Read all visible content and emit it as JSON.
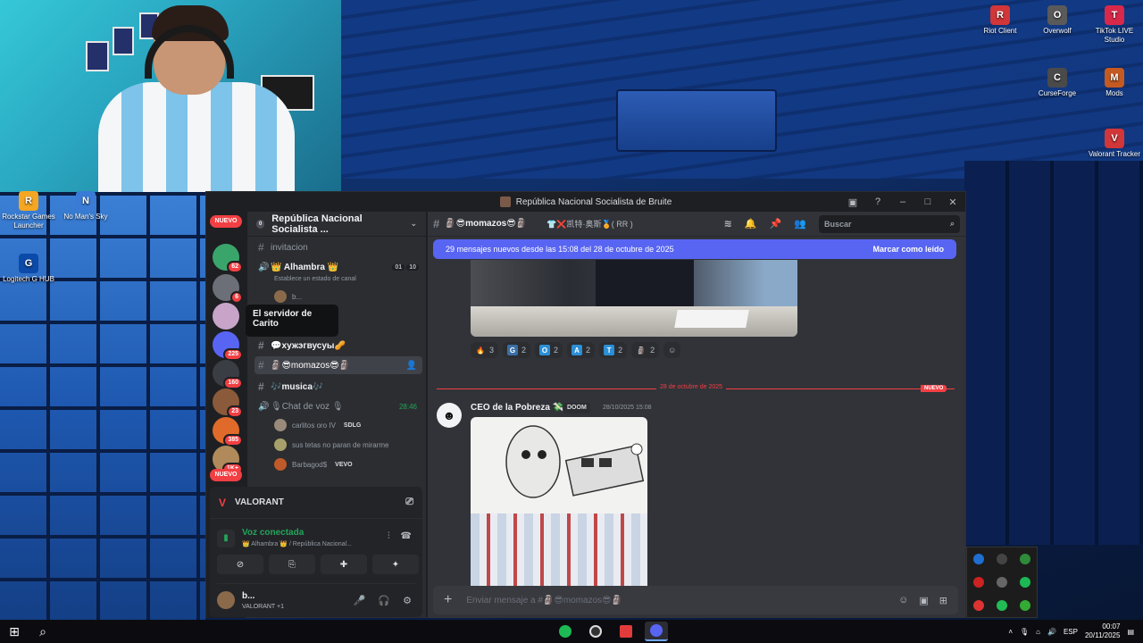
{
  "desktop": {
    "icons": [
      {
        "label": "Riot Client",
        "color": "#d13639",
        "glyph": "R"
      },
      {
        "label": "Overwolf",
        "color": "#5a5a5a",
        "glyph": "O"
      },
      {
        "label": "TikTok LIVE Studio",
        "color": "#d8294a",
        "glyph": "T"
      },
      {
        "label": "CurseForge",
        "color": "#4a4a4a",
        "glyph": "C"
      },
      {
        "label": "Mods",
        "color": "#c45a22",
        "glyph": "M"
      },
      {
        "label": "Valorant Tracker",
        "color": "#d13639",
        "glyph": "V"
      },
      {
        "label": "Rockstar Games Launcher",
        "color": "#f5a623",
        "glyph": "R"
      },
      {
        "label": "No Man's Sky",
        "color": "#3a7bd5",
        "glyph": "N"
      },
      {
        "label": "Logitech G HUB",
        "color": "#0b4aa8",
        "glyph": "G"
      }
    ]
  },
  "window": {
    "title": "República Nacional Socialista de Bruite"
  },
  "rail": {
    "nuevo_top": "NUEVO",
    "nuevo_bottom": "NUEVO",
    "badges": [
      "62",
      "6",
      "225",
      "160",
      "23",
      "385",
      "1K+"
    ]
  },
  "tooltip": {
    "text": "El servidor de Carito"
  },
  "guild": {
    "name": "República Nacional Socialista ..."
  },
  "channels": {
    "invitacion": "invitacion",
    "alhambra": "👑 Alhambra 👑",
    "alhambra_counts": [
      "01",
      "10"
    ],
    "alhambra_sub": "Establece un estado de canal",
    "alhambra_user": "b...",
    "xuj": "💬хужэгвусуы🥜",
    "momazos": "🗿😎momazos😎🗿",
    "musica": "🎶musica🎶",
    "voz": "🎙Chat de voz 🎙",
    "voz_time": "28:46",
    "voice_users": [
      {
        "name": "carlitos oro IV",
        "tag": "SDLG"
      },
      {
        "name": "sus tetas no paran de mirarme",
        "tag": ""
      },
      {
        "name": "Barbagod$",
        "tag": "VEVO"
      }
    ]
  },
  "panel": {
    "activity": "VALORANT",
    "voice_status": "Voz conectada",
    "voice_location": "👑 Alhambra 👑 / República Nacional...",
    "username": "b...",
    "user_status": "VALORANT +1"
  },
  "header": {
    "channel": "🗿😎momazos😎🗿",
    "topic": "👕❌凯特·奥斯🏅( RR )",
    "search_placeholder": "Buscar"
  },
  "newbar": {
    "text": "29 mensajes nuevos desde las 15:08 del 28 de octubre de 2025",
    "action": "Marcar como leído"
  },
  "reactions": [
    {
      "emoji": "🔥",
      "count": "3",
      "color": "#2b2d31"
    },
    {
      "emoji": "G",
      "count": "2",
      "color": "#3a6ea5"
    },
    {
      "emoji": "O",
      "count": "2",
      "color": "#2b8fd6"
    },
    {
      "emoji": "A",
      "count": "2",
      "color": "#2b8fd6"
    },
    {
      "emoji": "T",
      "count": "2",
      "color": "#2b8fd6"
    },
    {
      "emoji": "🗿",
      "count": "2",
      "color": "#2b2d31"
    }
  ],
  "divider": {
    "date": "28 de octubre de 2025",
    "new": "NUEVO"
  },
  "message": {
    "author": "CEO de la Pobreza 💸",
    "badge": "DOOM",
    "timestamp": "28/10/2025 15:08"
  },
  "composer": {
    "placeholder": "Enviar mensaje a #🗿😎momazos😎🗿"
  },
  "taskbar": {
    "lang": "ESP",
    "time": "00:07",
    "date": "20/11/2025"
  }
}
